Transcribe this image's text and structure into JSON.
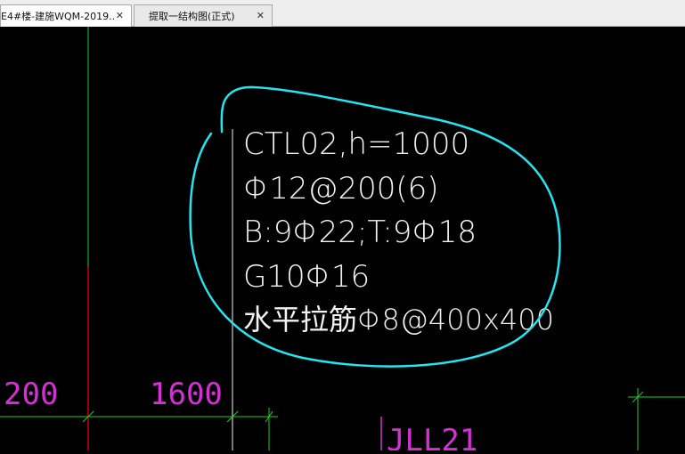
{
  "tabs": [
    {
      "label": "E4#楼-建施WQM-2019.…",
      "close": "✕",
      "active": true
    },
    {
      "label": "提取一结构图(正式)",
      "close": "✕",
      "active": false
    }
  ],
  "drawing": {
    "annotation_lines": [
      "CTL02,h=1000",
      "Φ12@200(6)",
      "B:9Φ22;T:9Φ18",
      "G10Φ16",
      "水平拉筋Φ8@400x400"
    ],
    "dimensions": [
      "200",
      "1600"
    ],
    "beam_label": "JLL21",
    "colors": {
      "background": "#000000",
      "green_line": "#22cc22",
      "red_line": "#cc0000",
      "magenta_text": "#d62fd6",
      "cyan_circle": "#22e6f0",
      "white_text": "#f2f2f2"
    }
  }
}
